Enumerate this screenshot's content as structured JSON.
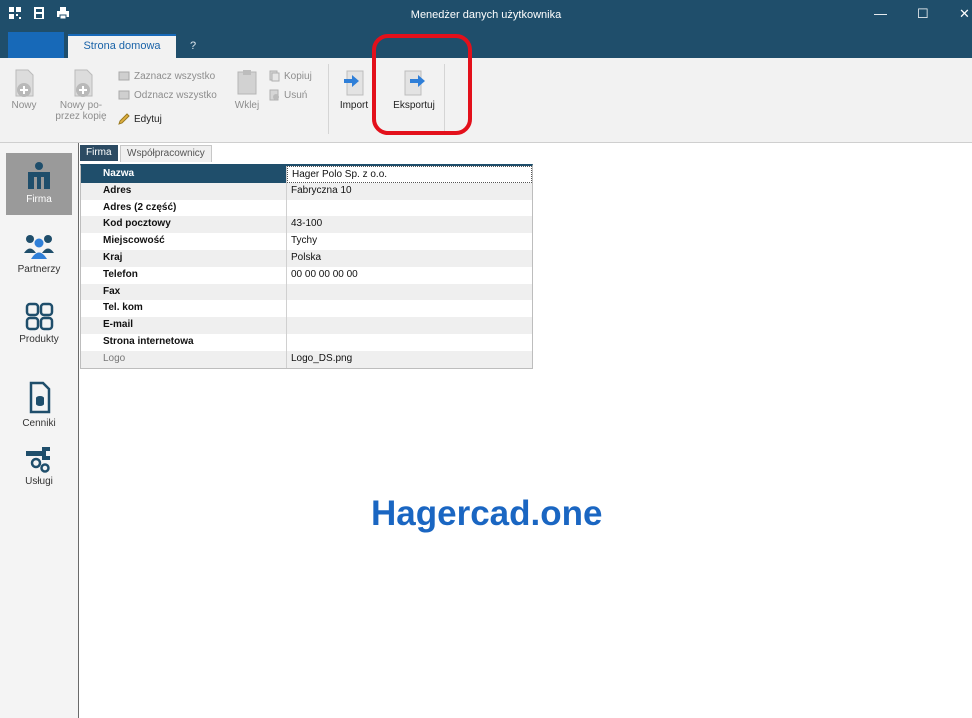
{
  "window": {
    "title": "Menedżer danych użytkownika",
    "controls": {
      "minimize": "—",
      "maximize": "☐",
      "close": "✕"
    }
  },
  "tabs": {
    "home": "Strona domowa",
    "help": "?"
  },
  "ribbon": {
    "new": "Nowy",
    "new_copy_line1": "Nowy po-",
    "new_copy_line2": "przez kopię",
    "select_all": "Zaznacz wszystko",
    "deselect_all": "Odznacz wszystko",
    "edit": "Edytuj",
    "paste": "Wklej",
    "copy": "Kopiuj",
    "delete": "Usuń",
    "import": "Import",
    "export": "Eksportuj"
  },
  "nav": [
    {
      "label": "Firma",
      "icon": "company-icon",
      "active": true
    },
    {
      "label": "Partnerzy",
      "icon": "partners-icon",
      "active": false
    },
    {
      "label": "Produkty",
      "icon": "products-icon",
      "active": false
    },
    {
      "label": "Cenniki",
      "icon": "pricelist-icon",
      "active": false
    },
    {
      "label": "Usługi",
      "icon": "services-icon",
      "active": false
    }
  ],
  "subtabs": {
    "company": "Firma",
    "coworkers": "Współpracownicy"
  },
  "company_fields": [
    {
      "label": "Nazwa",
      "value": "Hager Polo Sp. z o.o."
    },
    {
      "label": "Adres",
      "value": "Fabryczna 10"
    },
    {
      "label": "Adres (2 część)",
      "value": ""
    },
    {
      "label": "Kod pocztowy",
      "value": "43-100"
    },
    {
      "label": "Miejscowość",
      "value": "Tychy"
    },
    {
      "label": "Kraj",
      "value": "Polska"
    },
    {
      "label": "Telefon",
      "value": "00 00 00 00 00"
    },
    {
      "label": "Fax",
      "value": ""
    },
    {
      "label": "Tel. kom",
      "value": ""
    },
    {
      "label": "E-mail",
      "value": ""
    },
    {
      "label": "Strona internetowa",
      "value": ""
    },
    {
      "label": "Logo",
      "value": "Logo_DS.png"
    }
  ],
  "brand": "Hagercad.one",
  "colors": {
    "titlebar": "#1f4e6b",
    "accent": "#1769b8",
    "brand": "#1a66c2",
    "highlight": "#e3101b"
  }
}
